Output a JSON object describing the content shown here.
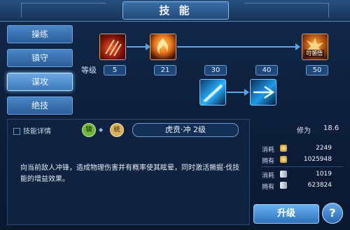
{
  "title": "技 能",
  "sidebar": {
    "items": [
      {
        "label": "操练",
        "active": false
      },
      {
        "label": "镇守",
        "active": false
      },
      {
        "label": "谋攻",
        "active": true
      },
      {
        "label": "绝技",
        "active": false
      }
    ]
  },
  "tree": {
    "level_label": "等级",
    "levels": [
      "5",
      "21",
      "30",
      "40",
      "50"
    ],
    "icon_text": {
      "skill4": "可领悟"
    }
  },
  "detail": {
    "header_label": "技能详情",
    "leaf_glyph": "镇",
    "badge_glyph": "统",
    "skill_name": "虎贲·冲 2级",
    "description": "向当前敌人冲锋，造成物理伤害并有概率使其眩晕，同时激活撅掘·伐技能的增益效果。"
  },
  "resources": {
    "xiuwei_label": "修为",
    "xiuwei_value": "18.6",
    "rows": [
      {
        "label": "消耗",
        "value": "2249",
        "icon": "gold-coin-icon"
      },
      {
        "label": "拥有",
        "value": "1025948",
        "icon": "gold-coin-icon"
      },
      {
        "label": "消耗",
        "value": "1019",
        "icon": "scroll-icon"
      },
      {
        "label": "拥有",
        "value": "623824",
        "icon": "scroll-icon"
      }
    ]
  },
  "buttons": {
    "upgrade_label": "升级",
    "help_label": "?"
  },
  "colors": {
    "accent": "#5aa6e8",
    "gold": "#d7b35f"
  }
}
